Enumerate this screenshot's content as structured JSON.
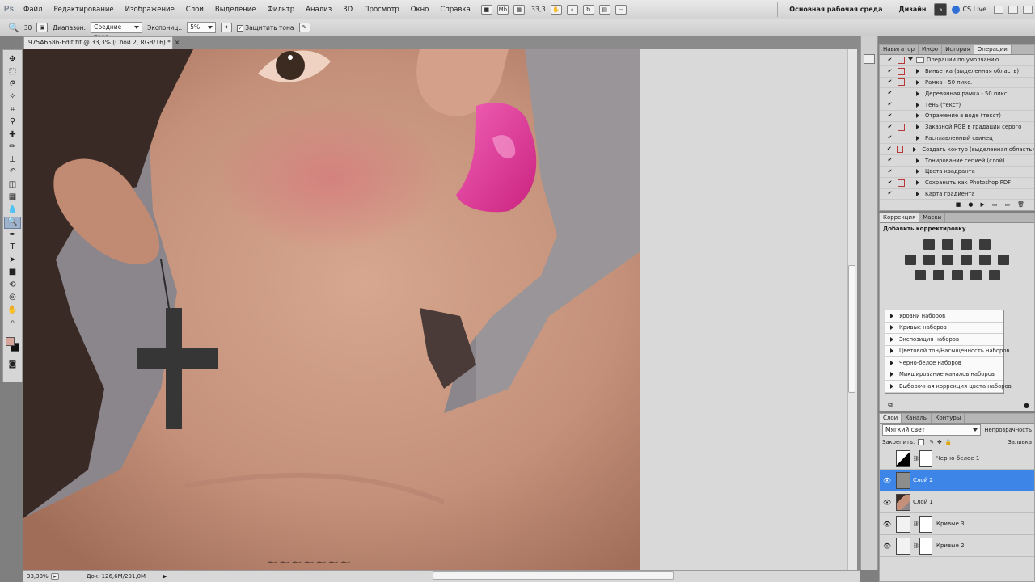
{
  "app": {
    "logo": "Ps"
  },
  "menu": {
    "items": [
      "Файл",
      "Редактирование",
      "Изображение",
      "Слои",
      "Выделение",
      "Фильтр",
      "Анализ",
      "3D",
      "Просмотр",
      "Окно",
      "Справка"
    ],
    "zoom_display": "33,3",
    "workspace_primary": "Основная рабочая среда",
    "workspace_secondary": "Дизайн",
    "cs_live": "CS Live"
  },
  "options_bar": {
    "brush_size": "30",
    "range_label": "Диапазон:",
    "range_value": "Средние тона",
    "exposure_label": "Экспониц.:",
    "exposure_value": "5%",
    "protect_tones_label": "Защитить тона",
    "protect_tones_checked": true
  },
  "document": {
    "tab_title": "975A6586-Edit.tif @ 33,3% (Слой 2, RGB/16) *",
    "zoom_status": "33,33%",
    "doc_size": "Док: 126,6M/291,0M"
  },
  "panels_top": {
    "tabs": [
      "Навигатор",
      "Инфо",
      "История",
      "Операции"
    ],
    "active_tab": "Операции",
    "set_name": "Операции по умолчанию",
    "actions": [
      {
        "label": "Виньетка (выделенная область)",
        "dialog": true
      },
      {
        "label": "Рамка - 50 пикс.",
        "dialog": true
      },
      {
        "label": "Деревянная рамка - 50 пикс.",
        "dialog": false
      },
      {
        "label": "Тень (текст)",
        "dialog": false
      },
      {
        "label": "Отражение в воде (текст)",
        "dialog": false
      },
      {
        "label": "Заказной RGB в градации серого",
        "dialog": true
      },
      {
        "label": "Расплавленный свинец",
        "dialog": false
      },
      {
        "label": "Создать контур (выделенная область)",
        "dialog": true
      },
      {
        "label": "Тонирование сепией (слой)",
        "dialog": false
      },
      {
        "label": "Цвета квадранта",
        "dialog": false
      },
      {
        "label": "Сохранить как Photoshop PDF",
        "dialog": true
      },
      {
        "label": "Карта градиента",
        "dialog": false
      }
    ]
  },
  "panels_adjust": {
    "tabs": [
      "Коррекция",
      "Маски"
    ],
    "active_tab": "Коррекция",
    "heading": "Добавить корректировку",
    "presets": [
      "Уровни наборов",
      "Кривые наборов",
      "Экспозиция наборов",
      "Цветовой тон/Насыщенность наборов",
      "Черно-белое наборов",
      "Микширование каналов наборов",
      "Выборочная коррекция цвета наборов"
    ]
  },
  "panels_layers": {
    "tabs": [
      "Слои",
      "Каналы",
      "Контуры"
    ],
    "active_tab": "Слои",
    "blend_mode": "Мягкий свет",
    "opacity_label": "Непрозрачность",
    "lock_label": "Закрепить:",
    "fill_label": "Заливка",
    "layers": [
      {
        "name": "Черно-белое 1",
        "visible": false,
        "selected": false,
        "type": "adjustment"
      },
      {
        "name": "Слой 2",
        "visible": true,
        "selected": true,
        "type": "gray"
      },
      {
        "name": "Слой 1",
        "visible": true,
        "selected": false,
        "type": "photo"
      },
      {
        "name": "Кривые 3",
        "visible": true,
        "selected": false,
        "type": "curves"
      },
      {
        "name": "Кривые 2",
        "visible": true,
        "selected": false,
        "type": "curves"
      }
    ]
  },
  "colors": {
    "accent_selection": "#3d86e8",
    "foreground_swatch": "#d9a49a",
    "background_swatch": "#111111",
    "lip_color": "#e03c9c"
  },
  "icons": {
    "tools": [
      "move-icon",
      "marquee-icon",
      "lasso-icon",
      "quick-select-icon",
      "crop-icon",
      "eyedropper-icon",
      "healing-brush-icon",
      "brush-icon",
      "clone-stamp-icon",
      "history-brush-icon",
      "eraser-icon",
      "gradient-icon",
      "blur-icon",
      "dodge-icon",
      "pen-icon",
      "type-icon",
      "path-select-icon",
      "shape-icon",
      "3d-rotate-icon",
      "3d-orbit-icon",
      "hand-icon",
      "zoom-icon"
    ]
  }
}
